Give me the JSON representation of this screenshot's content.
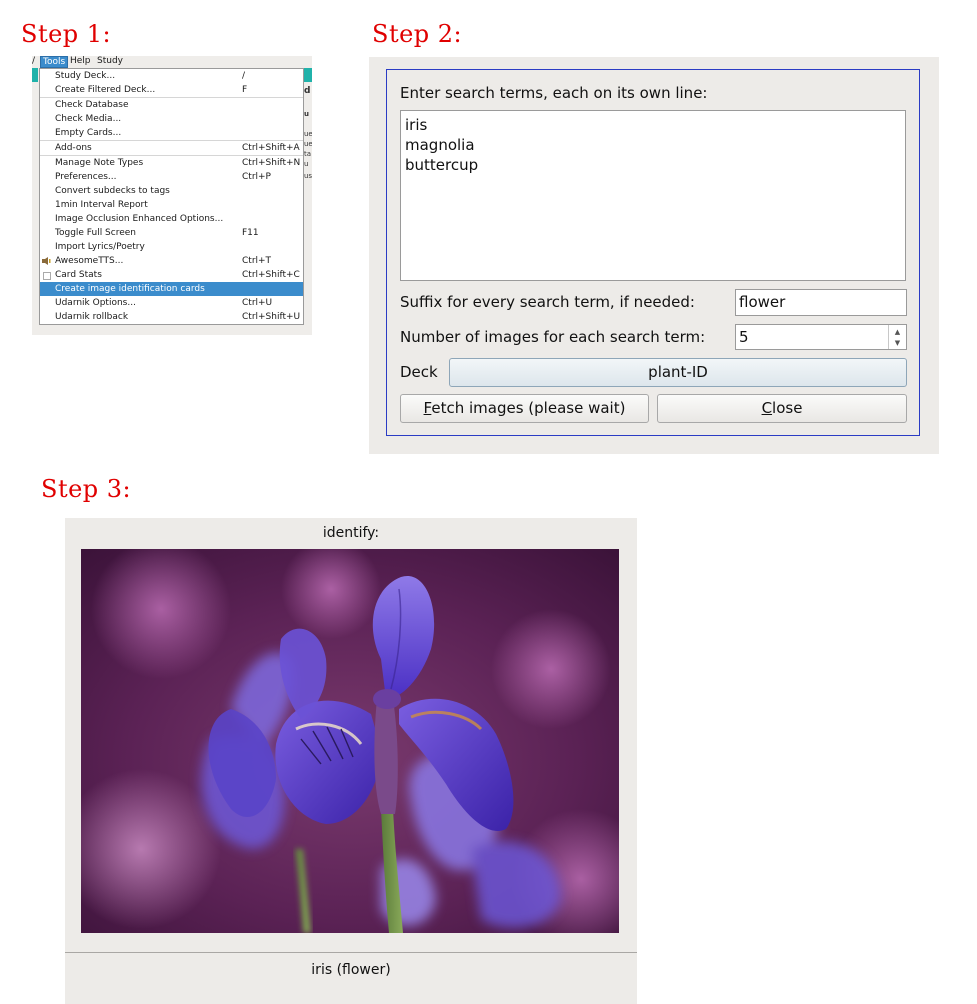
{
  "steps": {
    "step1": "Step 1:",
    "step2": "Step 2:",
    "step3": "Step 3:"
  },
  "menu": {
    "menubar": [
      "Tools",
      "Help",
      "Study"
    ],
    "items": [
      {
        "label": "Study Deck...",
        "shortcut": "/"
      },
      {
        "label": "Create Filtered Deck...",
        "shortcut": "F"
      },
      {
        "label": "Check Database",
        "shortcut": ""
      },
      {
        "label": "Check Media...",
        "shortcut": ""
      },
      {
        "label": "Empty Cards...",
        "shortcut": ""
      },
      {
        "label": "Add-ons",
        "shortcut": "Ctrl+Shift+A"
      },
      {
        "label": "Manage Note Types",
        "shortcut": "Ctrl+Shift+N"
      },
      {
        "label": "Preferences...",
        "shortcut": "Ctrl+P"
      },
      {
        "label": "Convert subdecks to tags",
        "shortcut": ""
      },
      {
        "label": "1min Interval Report",
        "shortcut": ""
      },
      {
        "label": "Image Occlusion Enhanced Options...",
        "shortcut": ""
      },
      {
        "label": "Toggle Full Screen",
        "shortcut": "F11"
      },
      {
        "label": "Import Lyrics/Poetry",
        "shortcut": ""
      },
      {
        "label": "AwesomeTTS...",
        "shortcut": "Ctrl+T"
      },
      {
        "label": "Card Stats",
        "shortcut": "Ctrl+Shift+C"
      },
      {
        "label": "Create image identification cards",
        "shortcut": ""
      },
      {
        "label": "Udarnik Options...",
        "shortcut": "Ctrl+U"
      },
      {
        "label": "Udarnik rollback",
        "shortcut": "Ctrl+Shift+U"
      }
    ],
    "highlight_color": "#3b8ccc"
  },
  "dialog": {
    "prompt": "Enter search terms, each on its own line:",
    "terms": [
      "iris",
      "magnolia",
      "buttercup"
    ],
    "suffix_label": "Suffix for every search term, if needed:",
    "suffix_value": "flower",
    "count_label": "Number of images for each search term:",
    "count_value": "5",
    "deck_label": "Deck",
    "deck_value": "plant-ID",
    "fetch_mnemonic": "F",
    "fetch_rest": "etch images (please wait)",
    "close_mnemonic": "C",
    "close_rest": "lose"
  },
  "card": {
    "question": "identify:",
    "answer": "iris (flower)"
  },
  "colors": {
    "step_label": "#e00000",
    "dialog_border": "#2b3cc4",
    "menu_teal": "#20b2aa"
  }
}
